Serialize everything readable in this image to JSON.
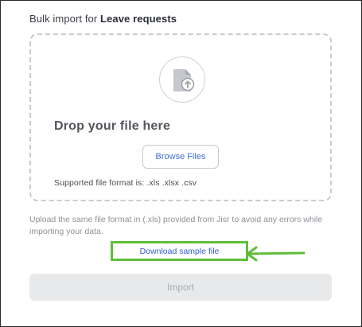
{
  "header": {
    "title_prefix": "Bulk import for ",
    "title_entity": "Leave requests"
  },
  "dropzone": {
    "icon": "file-upload-icon",
    "title": "Drop your file here",
    "browse_label": "Browse Files",
    "supported_formats": "Supported file format is: .xls .xlsx .csv"
  },
  "hint": "Upload the same file format in (.xls) provided from Jisr to avoid any errors while importing your data.",
  "download_sample_label": "Download sample file",
  "import_label": "Import",
  "colors": {
    "annotation_highlight": "#5fbe3a",
    "link": "#2f5fd0",
    "disabled_button_bg": "#e8e9eb"
  }
}
